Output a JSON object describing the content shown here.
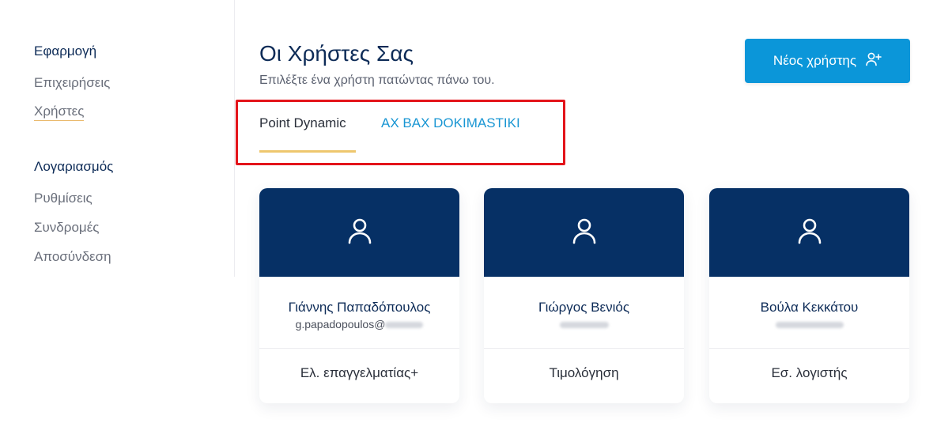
{
  "sidebar": {
    "sections": [
      {
        "title": "Εφαρμογή",
        "items": [
          "Επιχειρήσεις",
          "Χρήστες"
        ]
      },
      {
        "title": "Λογαριασμός",
        "items": [
          "Ρυθμίσεις",
          "Συνδρομές",
          "Αποσύνδεση"
        ]
      }
    ],
    "active_item": "Χρήστες"
  },
  "header": {
    "title": "Οι Χρήστες Σας",
    "subtitle": "Επιλέξτε ένα χρήστη πατώντας πάνω του.",
    "new_user_label": "Νέος χρήστης"
  },
  "tabs": [
    {
      "label": "Point Dynamic",
      "active": true
    },
    {
      "label": "AX BAX DOKIMASTIKI",
      "active": false
    }
  ],
  "colors": {
    "primary_navy": "#063065",
    "accent_blue": "#0b96d9",
    "tab_underline": "#eec76e",
    "highlight_red": "#e3141a"
  },
  "users": [
    {
      "name": "Γιάννης Παπαδόπουλος",
      "email_visible": "g.papadopoulos@",
      "role": "Ελ. επαγγελματίας+",
      "icon": "user-icon"
    },
    {
      "name": "Γιώργος Βενιός",
      "email_visible": "",
      "role": "Τιμολόγηση",
      "icon": "user-icon"
    },
    {
      "name": "Βούλα Κεκκάτου",
      "email_visible": "",
      "role": "Εσ. λογιστής",
      "icon": "user-icon"
    }
  ]
}
